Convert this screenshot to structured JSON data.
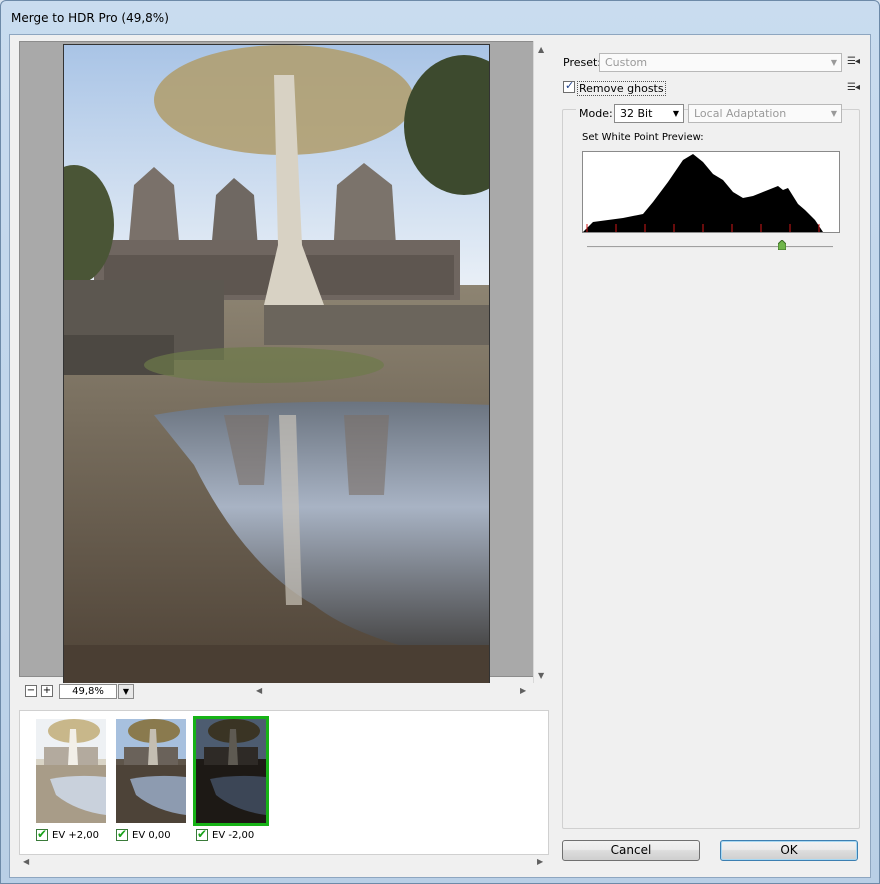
{
  "window": {
    "title": "Merge to HDR Pro (49,8%)"
  },
  "preview": {
    "zoom_value": "49,8%",
    "zoom_out_label": "−",
    "zoom_in_label": "+"
  },
  "thumbnails": [
    {
      "label": "EV +2,00",
      "checked": true,
      "selected": false
    },
    {
      "label": "EV 0,00",
      "checked": true,
      "selected": false
    },
    {
      "label": "EV -2,00",
      "checked": true,
      "selected": true
    }
  ],
  "settings": {
    "preset_label": "Preset:",
    "preset_value": "Custom",
    "remove_ghosts_label": "Remove ghosts",
    "remove_ghosts_checked": true,
    "mode_label": "Mode:",
    "mode_value": "32 Bit",
    "method_value": "Local Adaptation",
    "white_point_label": "Set White Point Preview:",
    "white_point_slider": 0.8
  },
  "buttons": {
    "cancel": "Cancel",
    "ok": "OK"
  },
  "colors": {
    "selected_thumb": "#17b317",
    "ok_border": "#3c7fb1"
  }
}
